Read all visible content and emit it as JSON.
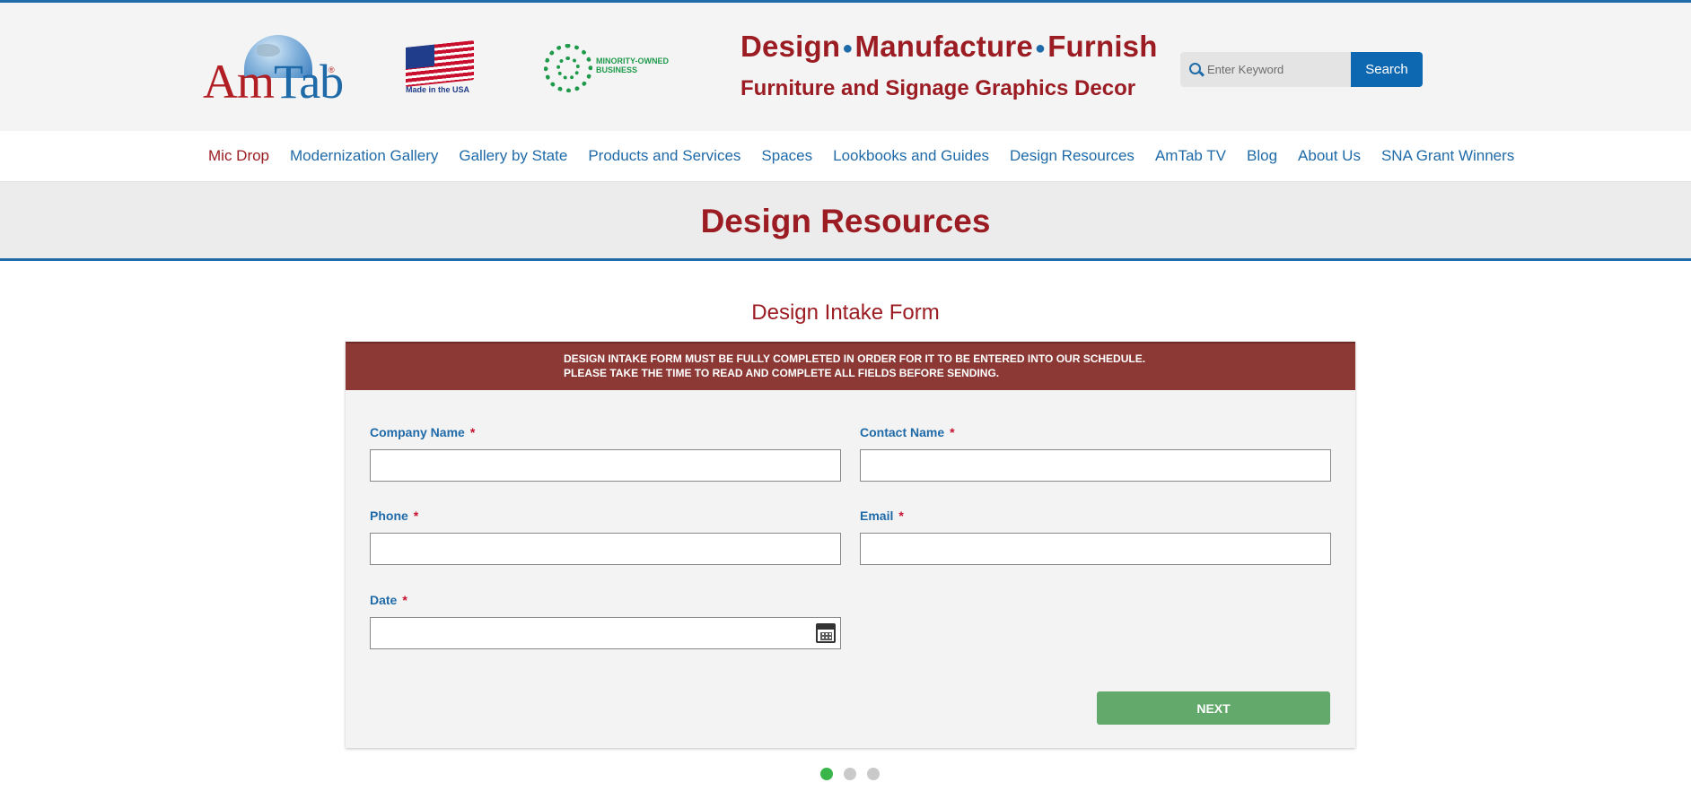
{
  "header": {
    "logo": {
      "am": "Am",
      "tab": "Tab",
      "reg": "®"
    },
    "made_in_usa": "Made in the USA",
    "minority_owned": "MINORITY-OWNED BUSINESS",
    "tagline_design": "Design",
    "tagline_manufacture": "Manufacture",
    "tagline_furnish": "Furnish",
    "tagline_sub": "Furniture and Signage Graphics Decor",
    "search": {
      "placeholder": "Enter Keyword",
      "button": "Search"
    }
  },
  "nav": {
    "items": [
      {
        "label": "Mic Drop",
        "active": true
      },
      {
        "label": "Modernization Gallery"
      },
      {
        "label": "Gallery by State"
      },
      {
        "label": "Products and Services"
      },
      {
        "label": "Spaces"
      },
      {
        "label": "Lookbooks and Guides"
      },
      {
        "label": "Design Resources"
      },
      {
        "label": "AmTab TV"
      },
      {
        "label": "Blog"
      },
      {
        "label": "About Us"
      },
      {
        "label": "SNA Grant Winners"
      }
    ]
  },
  "page": {
    "title": "Design Resources"
  },
  "form": {
    "title": "Design Intake Form",
    "notice_line1": "DESIGN INTAKE FORM MUST BE FULLY COMPLETED IN ORDER FOR IT TO BE ENTERED INTO OUR SCHEDULE.",
    "notice_line2": "PLEASE TAKE THE TIME TO READ AND COMPLETE ALL FIELDS BEFORE SENDING.",
    "required_marker": "*",
    "fields": {
      "company": {
        "label": "Company Name",
        "value": ""
      },
      "contact": {
        "label": "Contact Name",
        "value": ""
      },
      "phone": {
        "label": "Phone",
        "value": ""
      },
      "email": {
        "label": "Email",
        "value": ""
      },
      "date": {
        "label": "Date",
        "value": ""
      }
    },
    "next_button": "NEXT",
    "step_current": 1,
    "step_total": 3
  },
  "colors": {
    "brand_red": "#9b1c22",
    "brand_blue": "#1f6aa8",
    "notice_bg": "#8c3935",
    "next_green": "#63a96c",
    "pager_active": "#3ab54a"
  }
}
